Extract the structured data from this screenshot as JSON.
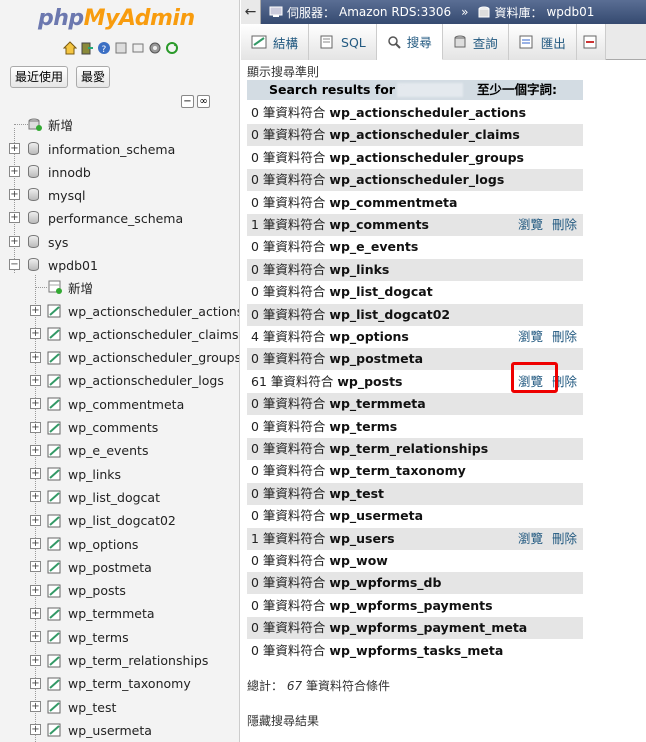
{
  "logo": {
    "php": "php",
    "admin": "MyAdmin"
  },
  "sidebar": {
    "recent_label": "最近使用",
    "favorites_label": "最愛",
    "new_label": "新增",
    "databases": [
      {
        "name": "information_schema"
      },
      {
        "name": "innodb"
      },
      {
        "name": "mysql"
      },
      {
        "name": "performance_schema"
      },
      {
        "name": "sys"
      },
      {
        "name": "wpdb01"
      }
    ],
    "wpdb01_new_label": "新增",
    "tables": [
      "wp_actionscheduler_actions",
      "wp_actionscheduler_claims",
      "wp_actionscheduler_groups",
      "wp_actionscheduler_logs",
      "wp_commentmeta",
      "wp_comments",
      "wp_e_events",
      "wp_links",
      "wp_list_dogcat",
      "wp_list_dogcat02",
      "wp_options",
      "wp_postmeta",
      "wp_posts",
      "wp_termmeta",
      "wp_terms",
      "wp_term_relationships",
      "wp_term_taxonomy",
      "wp_test",
      "wp_usermeta"
    ]
  },
  "breadcrumb": {
    "server_label": "伺服器：",
    "server": "Amazon RDS:3306",
    "db_label": "資料庫：",
    "db": "wpdb01"
  },
  "tabs": [
    {
      "label": "結構"
    },
    {
      "label": "SQL"
    },
    {
      "label": "搜尋"
    },
    {
      "label": "查詢"
    },
    {
      "label": "匯出"
    }
  ],
  "criteria_label": "顯示搜尋準則",
  "results_header": {
    "prefix": "Search results for \"",
    "suffix": "至少一個字詞:"
  },
  "row_mid": " 筆資料符合 ",
  "browse_label": "瀏覽",
  "delete_label": "刪除",
  "results": [
    {
      "count": "0",
      "table": "wp_actionscheduler_actions",
      "links": false
    },
    {
      "count": "0",
      "table": "wp_actionscheduler_claims",
      "links": false
    },
    {
      "count": "0",
      "table": "wp_actionscheduler_groups",
      "links": false
    },
    {
      "count": "0",
      "table": "wp_actionscheduler_logs",
      "links": false
    },
    {
      "count": "0",
      "table": "wp_commentmeta",
      "links": false
    },
    {
      "count": "1",
      "table": "wp_comments",
      "links": true
    },
    {
      "count": "0",
      "table": "wp_e_events",
      "links": false
    },
    {
      "count": "0",
      "table": "wp_links",
      "links": false
    },
    {
      "count": "0",
      "table": "wp_list_dogcat",
      "links": false
    },
    {
      "count": "0",
      "table": "wp_list_dogcat02",
      "links": false
    },
    {
      "count": "4",
      "table": "wp_options",
      "links": true
    },
    {
      "count": "0",
      "table": "wp_postmeta",
      "links": false
    },
    {
      "count": "61",
      "table": "wp_posts",
      "links": true
    },
    {
      "count": "0",
      "table": "wp_termmeta",
      "links": false
    },
    {
      "count": "0",
      "table": "wp_terms",
      "links": false
    },
    {
      "count": "0",
      "table": "wp_term_relationships",
      "links": false
    },
    {
      "count": "0",
      "table": "wp_term_taxonomy",
      "links": false
    },
    {
      "count": "0",
      "table": "wp_test",
      "links": false
    },
    {
      "count": "0",
      "table": "wp_usermeta",
      "links": false
    },
    {
      "count": "1",
      "table": "wp_users",
      "links": true
    },
    {
      "count": "0",
      "table": "wp_wow",
      "links": false
    },
    {
      "count": "0",
      "table": "wp_wpforms_db",
      "links": false
    },
    {
      "count": "0",
      "table": "wp_wpforms_payments",
      "links": false
    },
    {
      "count": "0",
      "table": "wp_wpforms_payment_meta",
      "links": false
    },
    {
      "count": "0",
      "table": "wp_wpforms_tasks_meta",
      "links": false
    }
  ],
  "total": {
    "prefix": "總計：",
    "count": "67",
    "suffix": "筆資料符合條件"
  },
  "hide_results_label": "隱藏搜尋結果",
  "colors": {
    "topbar": "#354a70",
    "link": "#235a81",
    "highlight": "#e00000",
    "row_alt": "#e5e5e5",
    "header": "#d3dce3"
  }
}
